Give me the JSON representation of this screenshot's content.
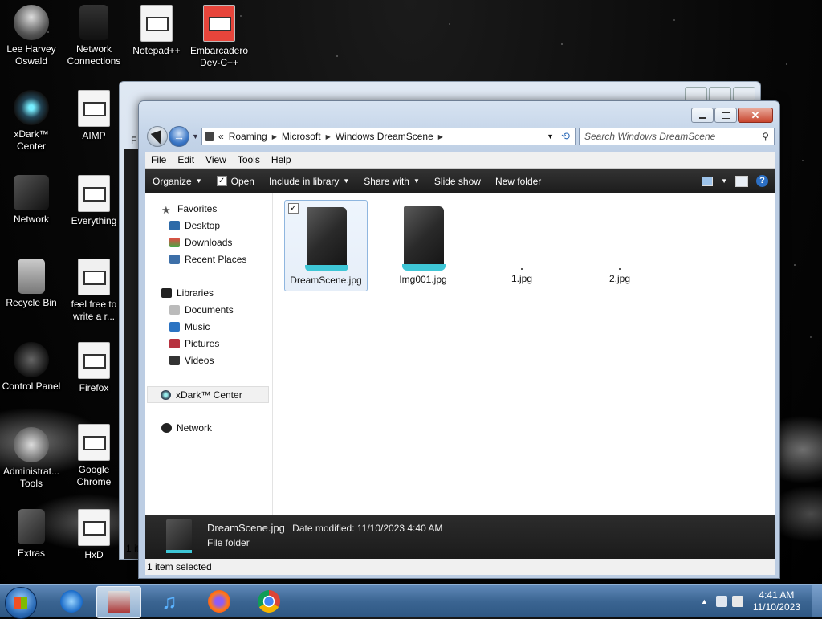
{
  "desktop": {
    "icons": [
      {
        "label": "Lee Harvey Oswald"
      },
      {
        "label": "Network Connections"
      },
      {
        "label": "Notepad++"
      },
      {
        "label": "Embarcadero Dev-C++"
      },
      {
        "label": "xDark™ Center"
      },
      {
        "label": "AIMP"
      },
      {
        "label": "Network"
      },
      {
        "label": "Everything"
      },
      {
        "label": "Recycle Bin"
      },
      {
        "label": "feel free to write a r..."
      },
      {
        "label": "Control Panel"
      },
      {
        "label": "Firefox"
      },
      {
        "label": "Administrat... Tools"
      },
      {
        "label": "Google Chrome"
      },
      {
        "label": "Extras"
      },
      {
        "label": "HxD"
      }
    ]
  },
  "explorer": {
    "address": {
      "overflow": "«",
      "crumbs": [
        "Roaming",
        "Microsoft",
        "Windows DreamScene"
      ]
    },
    "search_placeholder": "Search Windows DreamScene",
    "menu": [
      "File",
      "Edit",
      "View",
      "Tools",
      "Help"
    ],
    "commands": {
      "organize": "Organize",
      "open": "Open",
      "include": "Include in library",
      "share": "Share with",
      "slideshow": "Slide show",
      "newfolder": "New folder"
    },
    "nav": {
      "favorites": "Favorites",
      "desktop": "Desktop",
      "downloads": "Downloads",
      "recent": "Recent Places",
      "libraries": "Libraries",
      "documents": "Documents",
      "music": "Music",
      "pictures": "Pictures",
      "videos": "Videos",
      "xdark": "xDark™ Center",
      "network": "Network"
    },
    "files": [
      {
        "name": "DreamScene.jpg"
      },
      {
        "name": "Img001.jpg"
      },
      {
        "name": "1.jpg"
      },
      {
        "name": "2.jpg"
      }
    ],
    "details": {
      "name": "DreamScene.jpg",
      "modified": "Date modified: 11/10/2023 4:40 AM",
      "type": "File folder"
    },
    "status": "1 item selected"
  },
  "background_window": {
    "status_fragment": "1 it",
    "menu_fragment": "F"
  },
  "taskbar": {
    "time": "4:41 AM",
    "date": "11/10/2023"
  }
}
